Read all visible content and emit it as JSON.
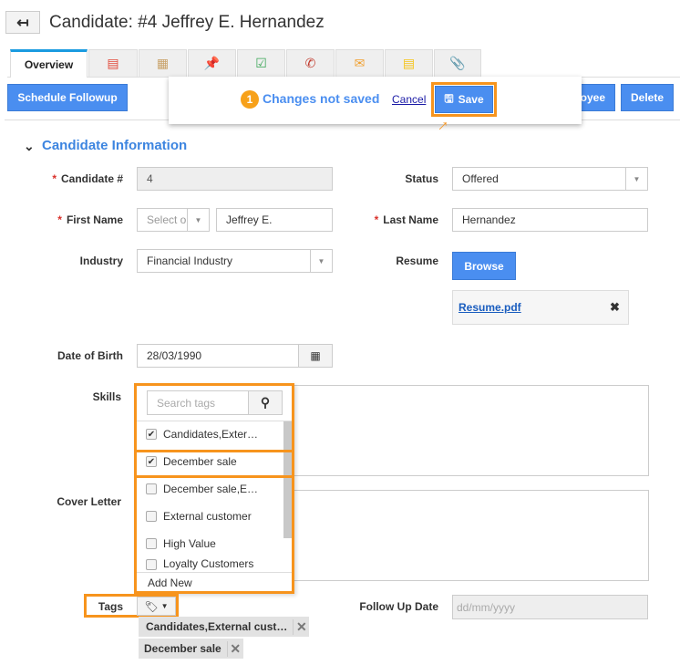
{
  "header": {
    "title": "Candidate: #4 Jeffrey E. Hernandez",
    "back_icon": "back-arrow-icon"
  },
  "tabs": [
    {
      "label": "Overview"
    },
    {
      "icon": "list-icon"
    },
    {
      "icon": "calendar-icon"
    },
    {
      "icon": "pin-icon"
    },
    {
      "icon": "task-icon"
    },
    {
      "icon": "phone-icon"
    },
    {
      "icon": "email-icon"
    },
    {
      "icon": "note-icon"
    },
    {
      "icon": "attachment-icon"
    }
  ],
  "toolbar": {
    "schedule_followup": "Schedule Followup",
    "employee_partial": "oyee",
    "delete": "Delete"
  },
  "save_popup": {
    "count": "1",
    "message": "Changes not saved",
    "cancel": "Cancel",
    "save": "Save"
  },
  "section": {
    "title": "Candidate Information"
  },
  "form": {
    "candidate_no_label": "Candidate #",
    "candidate_no": "4",
    "status_label": "Status",
    "status": "Offered",
    "first_name_label": "First Name",
    "salutation_placeholder": "Select or",
    "first_name": "Jeffrey E.",
    "last_name_label": "Last Name",
    "last_name": "Hernandez",
    "industry_label": "Industry",
    "industry": "Financial Industry",
    "resume_label": "Resume",
    "browse": "Browse",
    "resume_file": "Resume.pdf",
    "dob_label": "Date of Birth",
    "dob": "28/03/1990",
    "skills_label": "Skills",
    "cover_letter_label": "Cover Letter",
    "tags_label": "Tags",
    "followup_label": "Follow Up Date",
    "followup_placeholder": "dd/mm/yyyy"
  },
  "tag_dropdown": {
    "search_placeholder": "Search tags",
    "add_new": "Add New",
    "items": [
      {
        "label": "Candidates,Exter…",
        "checked": true
      },
      {
        "label": "December sale",
        "checked": true
      },
      {
        "label": "December sale,E…",
        "checked": false
      },
      {
        "label": "External customer",
        "checked": false
      },
      {
        "label": "High Value",
        "checked": false
      },
      {
        "label": "Loyalty Customers",
        "checked": false
      }
    ]
  },
  "selected_tags": [
    "Candidates,External cust…",
    "December sale"
  ],
  "colors": {
    "accent": "#4a8ef0",
    "highlight": "#f7941d",
    "section_title": "#3d85e0"
  }
}
